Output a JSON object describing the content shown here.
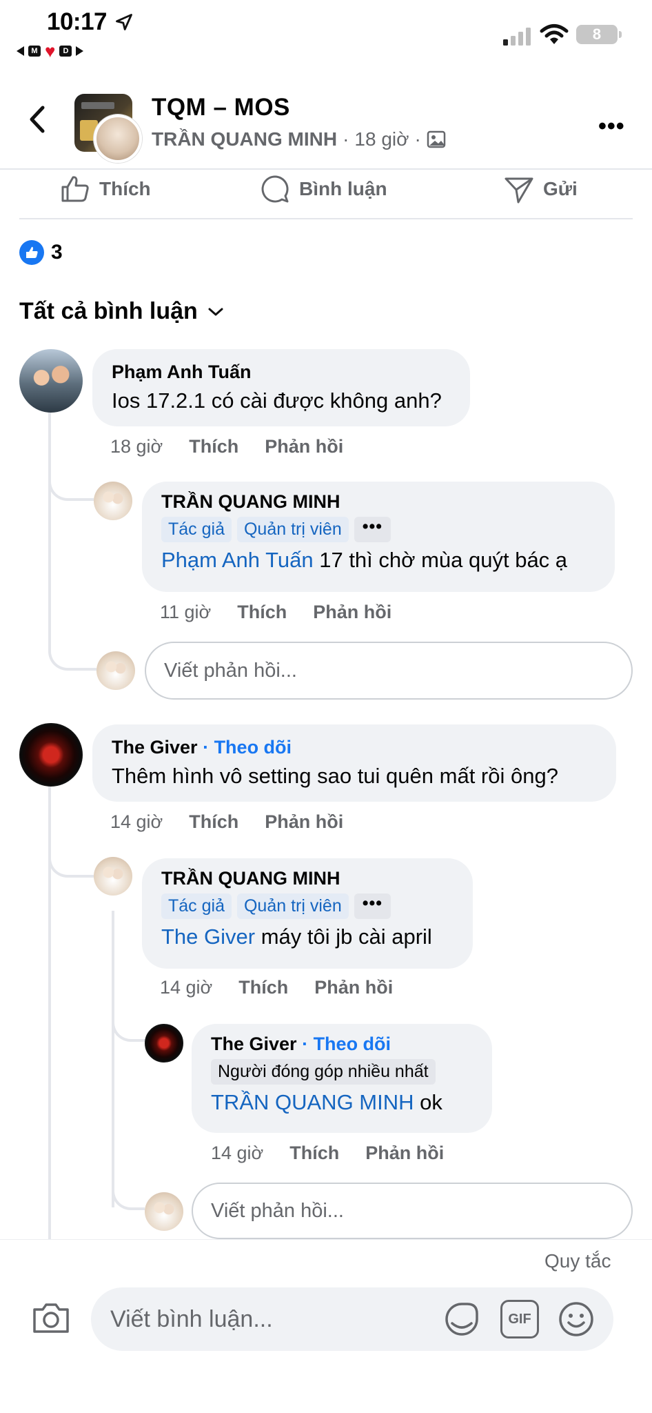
{
  "status_bar": {
    "time": "10:17",
    "back_app_letters": [
      "M",
      "D"
    ],
    "battery": "8"
  },
  "header": {
    "page_name": "TQM – MOS",
    "author": "TRẦN QUANG MINH",
    "separator": "·",
    "time_ago": "18 giờ",
    "icons": [
      "back-icon",
      "photo-icon",
      "more-icon"
    ]
  },
  "actions": {
    "like": "Thích",
    "comment": "Bình luận",
    "send": "Gửi"
  },
  "reactions": {
    "count": "3"
  },
  "comments_filter": {
    "label": "Tất cả bình luận"
  },
  "comments": [
    {
      "author": "Phạm Anh Tuấn",
      "text": "Ios 17.2.1 có cài được không anh?",
      "time": "18 giờ",
      "like": "Thích",
      "reply": "Phản hồi",
      "replies": [
        {
          "author": "TRẦN QUANG MINH",
          "badges": [
            "Tác giả",
            "Quản trị viên"
          ],
          "more": "•••",
          "mention": "Phạm Anh Tuấn",
          "text": " 17 thì chờ mùa quýt bác ạ",
          "time": "11 giờ",
          "like": "Thích",
          "reply": "Phản hồi"
        }
      ],
      "reply_placeholder": "Viết phản hồi..."
    },
    {
      "author": "The Giver",
      "follow": "Theo dõi",
      "text": "Thêm hình vô setting sao tui quên mất rồi ông?",
      "time": "14 giờ",
      "like": "Thích",
      "reply": "Phản hồi",
      "replies": [
        {
          "author": "TRẦN QUANG MINH",
          "badges": [
            "Tác giả",
            "Quản trị viên"
          ],
          "more": "•••",
          "mention": "The Giver",
          "text": " máy tôi jb cài april",
          "time": "14 giờ",
          "like": "Thích",
          "reply": "Phản hồi"
        },
        {
          "author": "The Giver",
          "follow": "Theo dõi",
          "badge": "Người đóng góp nhiều nhất",
          "mention": "TRẦN QUANG MINH",
          "text": " ok",
          "time": "14 giờ",
          "like": "Thích",
          "reply": "Phản hồi"
        }
      ],
      "reply_placeholder": "Viết phản hồi..."
    }
  ],
  "composer": {
    "rules": "Quy tắc",
    "placeholder": "Viết bình luận...",
    "gif": "GIF"
  },
  "colors": {
    "accent": "#1877f2",
    "mention": "#1565c0",
    "bubble": "#f0f2f5",
    "secondary_text": "#65676b"
  }
}
